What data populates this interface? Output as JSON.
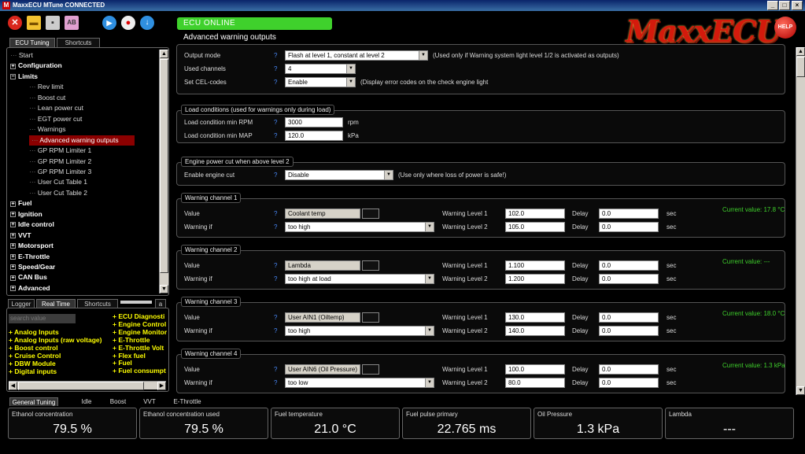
{
  "window": {
    "title": "MaxxECU MTune CONNECTED"
  },
  "status": {
    "online": "ECU ONLINE"
  },
  "page_title": "Advanced warning outputs",
  "logo": "MaxxECU",
  "help_label": "HELP",
  "left_tabs": [
    "ECU Tuning",
    "Shortcuts"
  ],
  "tree": [
    {
      "label": "Start",
      "level": 0,
      "kind": "leaf"
    },
    {
      "label": "Configuration",
      "level": 0,
      "kind": "plus"
    },
    {
      "label": "Limits",
      "level": 0,
      "kind": "minus"
    },
    {
      "label": "Rev limit",
      "level": 1,
      "kind": "leaf"
    },
    {
      "label": "Boost cut",
      "level": 1,
      "kind": "leaf"
    },
    {
      "label": "Lean power cut",
      "level": 1,
      "kind": "leaf"
    },
    {
      "label": "EGT power cut",
      "level": 1,
      "kind": "leaf"
    },
    {
      "label": "Warnings",
      "level": 1,
      "kind": "leaf"
    },
    {
      "label": "Advanced warning outputs",
      "level": 1,
      "kind": "leaf",
      "selected": true
    },
    {
      "label": "GP RPM Limiter 1",
      "level": 1,
      "kind": "leaf"
    },
    {
      "label": "GP RPM Limiter 2",
      "level": 1,
      "kind": "leaf"
    },
    {
      "label": "GP RPM Limiter 3",
      "level": 1,
      "kind": "leaf"
    },
    {
      "label": "User Cut Table 1",
      "level": 1,
      "kind": "leaf"
    },
    {
      "label": "User Cut Table 2",
      "level": 1,
      "kind": "leaf"
    },
    {
      "label": "Fuel",
      "level": 0,
      "kind": "plus"
    },
    {
      "label": "Ignition",
      "level": 0,
      "kind": "plus"
    },
    {
      "label": "Idle control",
      "level": 0,
      "kind": "plus"
    },
    {
      "label": "VVT",
      "level": 0,
      "kind": "plus"
    },
    {
      "label": "Motorsport",
      "level": 0,
      "kind": "plus"
    },
    {
      "label": "E-Throttle",
      "level": 0,
      "kind": "plus"
    },
    {
      "label": "Speed/Gear",
      "level": 0,
      "kind": "plus"
    },
    {
      "label": "CAN Bus",
      "level": 0,
      "kind": "plus"
    },
    {
      "label": "Advanced",
      "level": 0,
      "kind": "plus"
    }
  ],
  "rt_tabs": [
    "Logger",
    "Real Time",
    "Shortcuts",
    "a"
  ],
  "rt_search_placeholder": "search value",
  "rt_col1": [
    "+ Analog Inputs",
    "+ Analog Inputs (raw voltage)",
    "+ Boost control",
    "+ Cruise Control",
    "+ DBW Module",
    "+ Digital inputs"
  ],
  "rt_col2": [
    "+ ECU Diagnosti",
    "+ Engine Control",
    "+ Engine Monitor",
    "+ E-Throttle",
    "+ E-Throttle Volt",
    "+ Flex fuel",
    "+ Fuel",
    "+ Fuel consumpt"
  ],
  "top": {
    "output_mode_label": "Output mode",
    "output_mode_value": "Flash at level 1, constant at level 2",
    "output_mode_note": "(Used only if Warning system light level 1/2 is activated as outputs)",
    "used_channels_label": "Used channels",
    "used_channels_value": "4",
    "set_cel_label": "Set CEL-codes",
    "set_cel_value": "Enable",
    "set_cel_note": "(Display error codes on the check engine light"
  },
  "load": {
    "title": "Load conditions (used for warnings only during load)",
    "rpm_label": "Load condition min RPM",
    "rpm_value": "3000",
    "rpm_unit": "rpm",
    "map_label": "Load condition min MAP",
    "map_value": "120.0",
    "map_unit": "kPa"
  },
  "powercut": {
    "title": "Engine power cut when above level 2",
    "label": "Enable engine cut",
    "value": "Disable",
    "note": "(Use only where loss of power is safe!)"
  },
  "channel_common": {
    "value_label": "Value",
    "warning_if_label": "Warning if",
    "level1_label": "Warning Level 1",
    "level2_label": "Warning Level 2",
    "delay_label": "Delay",
    "sec_label": "sec",
    "q": "?"
  },
  "channels": [
    {
      "title": "Warning channel 1",
      "value": "Coolant temp",
      "warning_if": "too high",
      "level1": "102.0",
      "level2": "105.0",
      "delay1": "0.0",
      "delay2": "0.0",
      "current": "Current value: 17.8 °C"
    },
    {
      "title": "Warning channel 2",
      "value": "Lambda",
      "warning_if": "too high at load",
      "level1": "1.100",
      "level2": "1.200",
      "delay1": "0.0",
      "delay2": "0.0",
      "current": "Current value: ---"
    },
    {
      "title": "Warning channel 3",
      "value": "User AIN1 (Oiltemp)",
      "warning_if": "too high",
      "level1": "130.0",
      "level2": "140.0",
      "delay1": "0.0",
      "delay2": "0.0",
      "current": "Current value: 18.0 °C"
    },
    {
      "title": "Warning channel 4",
      "value": "User AIN6 (Oil Pressure)",
      "warning_if": "too low",
      "level1": "100.0",
      "level2": "80.0",
      "delay1": "0.0",
      "delay2": "0.0",
      "current": "Current value: 1.3 kPa"
    }
  ],
  "bottom_tabs": [
    "General Tuning",
    "Idle",
    "Boost",
    "VVT",
    "E-Throttle"
  ],
  "gauges": [
    {
      "label": "Ethanol concentration",
      "value": "79.5 %"
    },
    {
      "label": "Ethanol concentration used",
      "value": "79.5 %"
    },
    {
      "label": "Fuel temperature",
      "value": "21.0 °C"
    },
    {
      "label": "Fuel pulse primary",
      "value": "22.765 ms"
    },
    {
      "label": "Oil Pressure",
      "value": "1.3 kPa"
    },
    {
      "label": "Lambda",
      "value": "---"
    }
  ],
  "colors": {
    "online": "#3fd12c",
    "accent": "#d41a0c",
    "selected": "#8b0000",
    "current_value": "#3fd12c"
  }
}
